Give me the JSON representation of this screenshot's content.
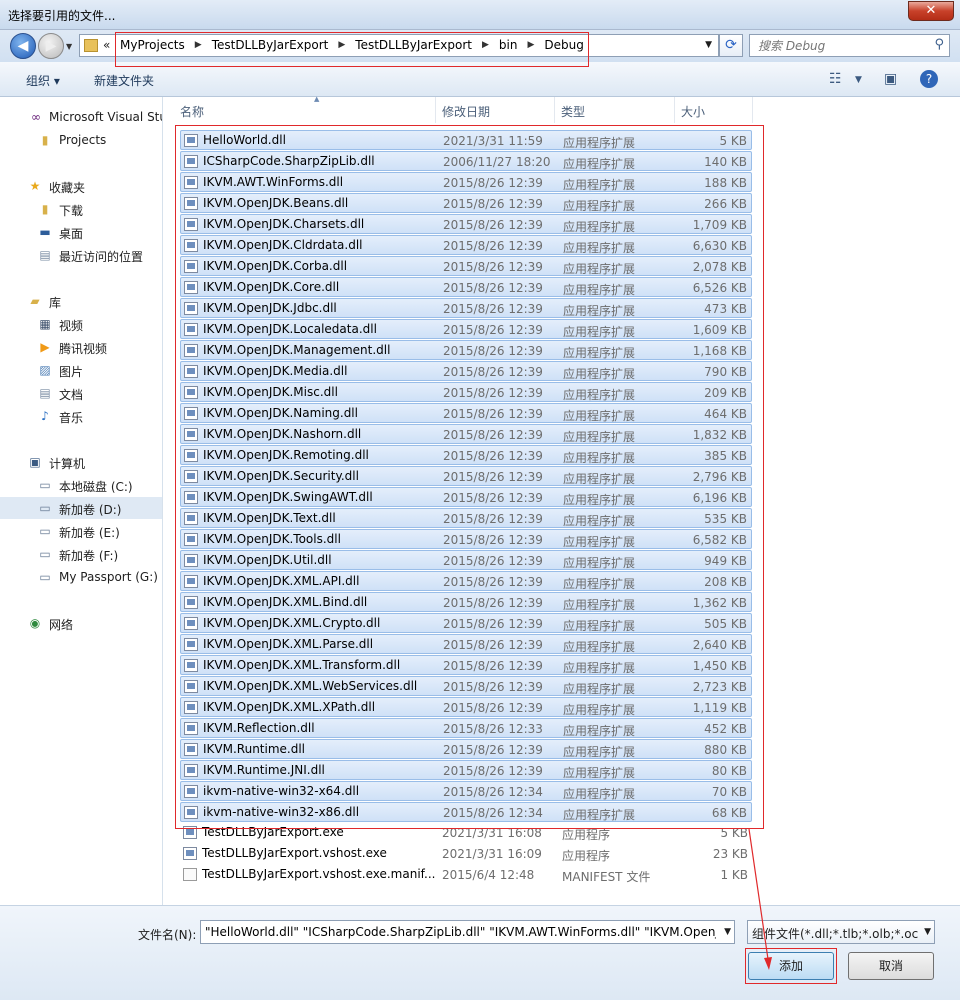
{
  "window": {
    "title": "选择要引用的文件..."
  },
  "address": {
    "crumbs": [
      "MyProjects",
      "TestDLLByJarExport",
      "TestDLLByJarExport",
      "bin",
      "Debug"
    ],
    "overflow": "«",
    "search_placeholder": "搜索 Debug"
  },
  "toolbar": {
    "organize": "组织 ▾",
    "new_folder": "新建文件夹"
  },
  "sidebar": {
    "items": [
      {
        "label": "Microsoft Visual Stu",
        "icon": "visual-studio-icon"
      },
      {
        "label": "Projects",
        "icon": "folder-icon"
      },
      {
        "label": "收藏夹",
        "icon": "star-icon"
      },
      {
        "label": "下载",
        "icon": "download-folder-icon"
      },
      {
        "label": "桌面",
        "icon": "desktop-icon"
      },
      {
        "label": "最近访问的位置",
        "icon": "recent-places-icon"
      },
      {
        "label": "库",
        "icon": "library-icon"
      },
      {
        "label": "视频",
        "icon": "video-icon"
      },
      {
        "label": "腾讯视频",
        "icon": "tencent-video-icon"
      },
      {
        "label": "图片",
        "icon": "pictures-icon"
      },
      {
        "label": "文档",
        "icon": "documents-icon"
      },
      {
        "label": "音乐",
        "icon": "music-icon"
      },
      {
        "label": "计算机",
        "icon": "computer-icon"
      },
      {
        "label": "本地磁盘 (C:)",
        "icon": "drive-c-icon"
      },
      {
        "label": "新加卷 (D:)",
        "icon": "drive-icon"
      },
      {
        "label": "新加卷 (E:)",
        "icon": "drive-icon"
      },
      {
        "label": "新加卷 (F:)",
        "icon": "drive-icon"
      },
      {
        "label": "My Passport (G:)",
        "icon": "drive-icon"
      },
      {
        "label": "网络",
        "icon": "network-icon"
      }
    ]
  },
  "columns": {
    "name": "名称",
    "date": "修改日期",
    "type": "类型",
    "size": "大小"
  },
  "files": [
    {
      "name": "HelloWorld.dll",
      "date": "2021/3/31 11:59",
      "type": "应用程序扩展",
      "size": "5 KB",
      "selected": true
    },
    {
      "name": "ICSharpCode.SharpZipLib.dll",
      "date": "2006/11/27 18:20",
      "type": "应用程序扩展",
      "size": "140 KB",
      "selected": true
    },
    {
      "name": "IKVM.AWT.WinForms.dll",
      "date": "2015/8/26 12:39",
      "type": "应用程序扩展",
      "size": "188 KB",
      "selected": true
    },
    {
      "name": "IKVM.OpenJDK.Beans.dll",
      "date": "2015/8/26 12:39",
      "type": "应用程序扩展",
      "size": "266 KB",
      "selected": true
    },
    {
      "name": "IKVM.OpenJDK.Charsets.dll",
      "date": "2015/8/26 12:39",
      "type": "应用程序扩展",
      "size": "1,709 KB",
      "selected": true
    },
    {
      "name": "IKVM.OpenJDK.Cldrdata.dll",
      "date": "2015/8/26 12:39",
      "type": "应用程序扩展",
      "size": "6,630 KB",
      "selected": true
    },
    {
      "name": "IKVM.OpenJDK.Corba.dll",
      "date": "2015/8/26 12:39",
      "type": "应用程序扩展",
      "size": "2,078 KB",
      "selected": true
    },
    {
      "name": "IKVM.OpenJDK.Core.dll",
      "date": "2015/8/26 12:39",
      "type": "应用程序扩展",
      "size": "6,526 KB",
      "selected": true
    },
    {
      "name": "IKVM.OpenJDK.Jdbc.dll",
      "date": "2015/8/26 12:39",
      "type": "应用程序扩展",
      "size": "473 KB",
      "selected": true
    },
    {
      "name": "IKVM.OpenJDK.Localedata.dll",
      "date": "2015/8/26 12:39",
      "type": "应用程序扩展",
      "size": "1,609 KB",
      "selected": true
    },
    {
      "name": "IKVM.OpenJDK.Management.dll",
      "date": "2015/8/26 12:39",
      "type": "应用程序扩展",
      "size": "1,168 KB",
      "selected": true
    },
    {
      "name": "IKVM.OpenJDK.Media.dll",
      "date": "2015/8/26 12:39",
      "type": "应用程序扩展",
      "size": "790 KB",
      "selected": true
    },
    {
      "name": "IKVM.OpenJDK.Misc.dll",
      "date": "2015/8/26 12:39",
      "type": "应用程序扩展",
      "size": "209 KB",
      "selected": true
    },
    {
      "name": "IKVM.OpenJDK.Naming.dll",
      "date": "2015/8/26 12:39",
      "type": "应用程序扩展",
      "size": "464 KB",
      "selected": true
    },
    {
      "name": "IKVM.OpenJDK.Nashorn.dll",
      "date": "2015/8/26 12:39",
      "type": "应用程序扩展",
      "size": "1,832 KB",
      "selected": true
    },
    {
      "name": "IKVM.OpenJDK.Remoting.dll",
      "date": "2015/8/26 12:39",
      "type": "应用程序扩展",
      "size": "385 KB",
      "selected": true
    },
    {
      "name": "IKVM.OpenJDK.Security.dll",
      "date": "2015/8/26 12:39",
      "type": "应用程序扩展",
      "size": "2,796 KB",
      "selected": true
    },
    {
      "name": "IKVM.OpenJDK.SwingAWT.dll",
      "date": "2015/8/26 12:39",
      "type": "应用程序扩展",
      "size": "6,196 KB",
      "selected": true
    },
    {
      "name": "IKVM.OpenJDK.Text.dll",
      "date": "2015/8/26 12:39",
      "type": "应用程序扩展",
      "size": "535 KB",
      "selected": true
    },
    {
      "name": "IKVM.OpenJDK.Tools.dll",
      "date": "2015/8/26 12:39",
      "type": "应用程序扩展",
      "size": "6,582 KB",
      "selected": true
    },
    {
      "name": "IKVM.OpenJDK.Util.dll",
      "date": "2015/8/26 12:39",
      "type": "应用程序扩展",
      "size": "949 KB",
      "selected": true
    },
    {
      "name": "IKVM.OpenJDK.XML.API.dll",
      "date": "2015/8/26 12:39",
      "type": "应用程序扩展",
      "size": "208 KB",
      "selected": true
    },
    {
      "name": "IKVM.OpenJDK.XML.Bind.dll",
      "date": "2015/8/26 12:39",
      "type": "应用程序扩展",
      "size": "1,362 KB",
      "selected": true
    },
    {
      "name": "IKVM.OpenJDK.XML.Crypto.dll",
      "date": "2015/8/26 12:39",
      "type": "应用程序扩展",
      "size": "505 KB",
      "selected": true
    },
    {
      "name": "IKVM.OpenJDK.XML.Parse.dll",
      "date": "2015/8/26 12:39",
      "type": "应用程序扩展",
      "size": "2,640 KB",
      "selected": true
    },
    {
      "name": "IKVM.OpenJDK.XML.Transform.dll",
      "date": "2015/8/26 12:39",
      "type": "应用程序扩展",
      "size": "1,450 KB",
      "selected": true
    },
    {
      "name": "IKVM.OpenJDK.XML.WebServices.dll",
      "date": "2015/8/26 12:39",
      "type": "应用程序扩展",
      "size": "2,723 KB",
      "selected": true
    },
    {
      "name": "IKVM.OpenJDK.XML.XPath.dll",
      "date": "2015/8/26 12:39",
      "type": "应用程序扩展",
      "size": "1,119 KB",
      "selected": true
    },
    {
      "name": "IKVM.Reflection.dll",
      "date": "2015/8/26 12:33",
      "type": "应用程序扩展",
      "size": "452 KB",
      "selected": true
    },
    {
      "name": "IKVM.Runtime.dll",
      "date": "2015/8/26 12:39",
      "type": "应用程序扩展",
      "size": "880 KB",
      "selected": true
    },
    {
      "name": "IKVM.Runtime.JNI.dll",
      "date": "2015/8/26 12:39",
      "type": "应用程序扩展",
      "size": "80 KB",
      "selected": true
    },
    {
      "name": "ikvm-native-win32-x64.dll",
      "date": "2015/8/26 12:34",
      "type": "应用程序扩展",
      "size": "70 KB",
      "selected": true
    },
    {
      "name": "ikvm-native-win32-x86.dll",
      "date": "2015/8/26 12:34",
      "type": "应用程序扩展",
      "size": "68 KB",
      "selected": true
    },
    {
      "name": "TestDLLByJarExport.exe",
      "date": "2021/3/31 16:08",
      "type": "应用程序",
      "size": "5 KB",
      "selected": false
    },
    {
      "name": "TestDLLByJarExport.vshost.exe",
      "date": "2021/3/31 16:09",
      "type": "应用程序",
      "size": "23 KB",
      "selected": false
    },
    {
      "name": "TestDLLByJarExport.vshost.exe.manif...",
      "date": "2015/6/4 12:48",
      "type": "MANIFEST 文件",
      "size": "1 KB",
      "selected": false
    }
  ],
  "footer": {
    "filename_label": "文件名(N):",
    "filename_value": "\"HelloWorld.dll\" \"ICSharpCode.SharpZipLib.dll\" \"IKVM.AWT.WinForms.dll\" \"IKVM.OpenJI",
    "filter": "组件文件(*.dll;*.tlb;*.olb;*.ocx;",
    "add_button": "添加",
    "cancel_button": "取消"
  }
}
